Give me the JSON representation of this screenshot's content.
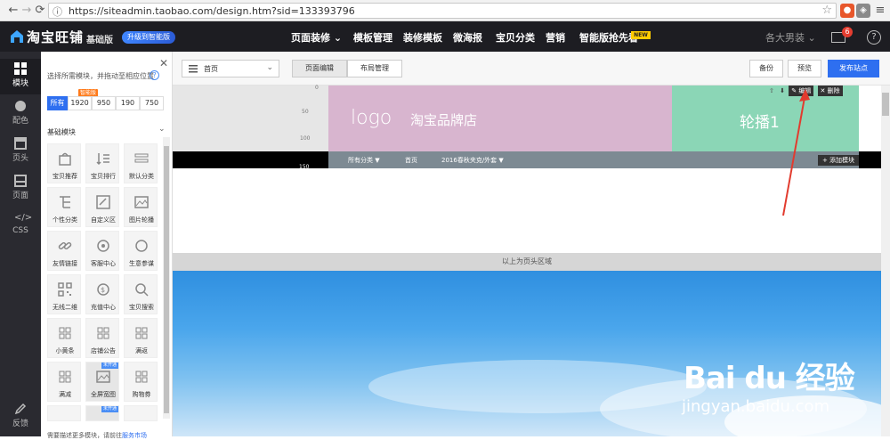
{
  "browser": {
    "url": "https://siteadmin.taobao.com/design.htm?sid=133393796"
  },
  "topbar": {
    "brand": "淘宝旺铺",
    "edition": "基础版",
    "upgrade": "升级到智能版",
    "nav": [
      "页面装修 ⌄",
      "模板管理",
      "装修模板",
      "微海报",
      "宝贝分类",
      "营销",
      "智能版抢先看"
    ],
    "new_badge": "NEW",
    "shop_select": "各大男装 ⌄",
    "mail_count": "6",
    "help": "?"
  },
  "rail": {
    "items": [
      "模块",
      "配色",
      "页头",
      "页面",
      "CSS",
      "反馈"
    ]
  },
  "panel": {
    "hint": "选择所需模块，并拖动至相应位置",
    "smart_tag": "智能版",
    "widths": [
      "所有",
      "1920",
      "950",
      "190",
      "750"
    ],
    "section": "基础模块",
    "tiles": [
      "宝贝推荐",
      "宝贝排行",
      "默认分类",
      "个性分类",
      "自定义区",
      "图片轮播",
      "友情链接",
      "客服中心",
      "生意参谋",
      "无线二维",
      "充值中心",
      "宝贝搜索",
      "小黄条",
      "店铺公告",
      "满返",
      "满减",
      "全屏宽图",
      "购物券"
    ],
    "locked_label": "未开通",
    "bottom_text": "需要描述更多模块，请前往",
    "bottom_link": "服务市场"
  },
  "toolbar": {
    "page": "首页",
    "tab_edit": "页面编辑",
    "tab_layout": "布局管理",
    "backup": "备份",
    "preview": "预览",
    "publish": "发布站点"
  },
  "canvas": {
    "ruler": [
      "0",
      "50",
      "100",
      "150"
    ],
    "logo": "logo",
    "shop_name": "淘宝品牌店",
    "carousel": "轮播1",
    "edit": "编辑",
    "delete": "删除",
    "nav": [
      "所有分类 ▼",
      "首页",
      "2016春秋夹克/外套 ▼"
    ],
    "add_module": "添加模块",
    "divider": "以上为页头区域"
  },
  "watermark": {
    "brand": "Bai du 经验",
    "sub": "jingyan.baidu.com"
  }
}
